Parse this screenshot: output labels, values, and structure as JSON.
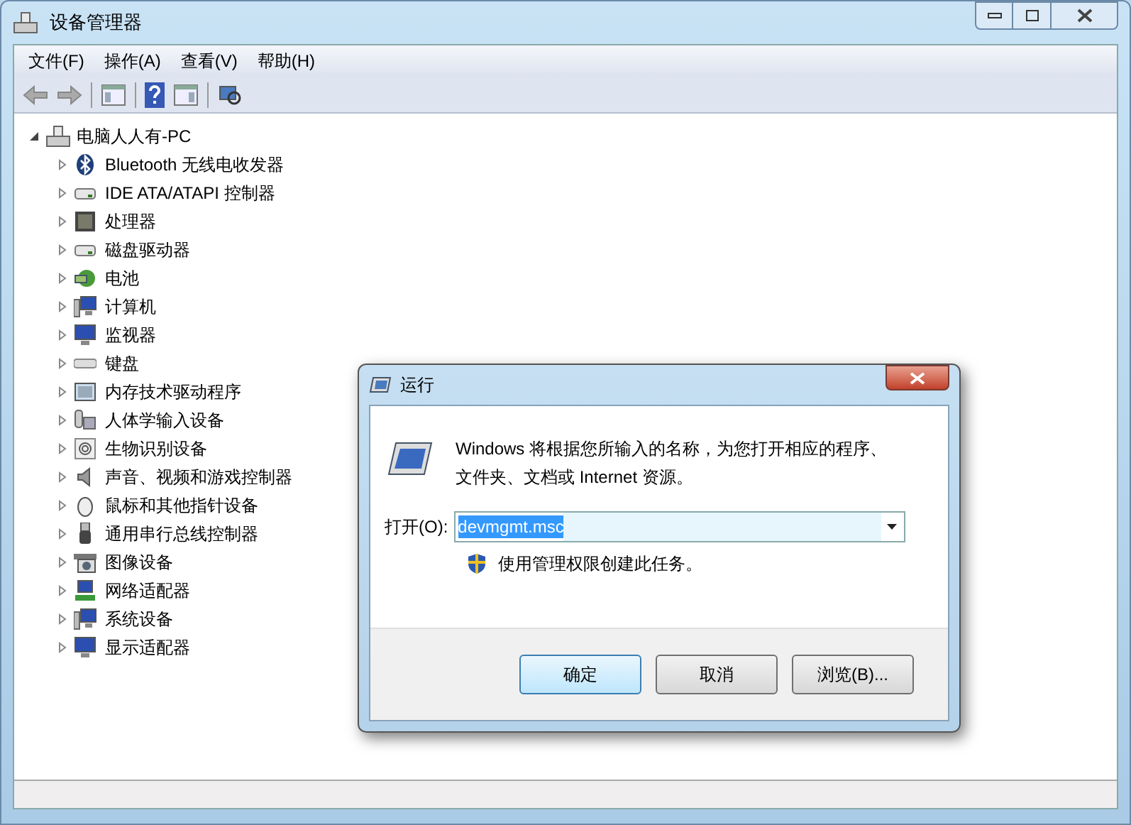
{
  "window": {
    "title": "设备管理器"
  },
  "menu": [
    "文件(F)",
    "操作(A)",
    "查看(V)",
    "帮助(H)"
  ],
  "tree": {
    "label": "电脑人人有-PC",
    "expanded": true,
    "children": [
      {
        "label": "Bluetooth 无线电收发器",
        "kind": "bluetooth",
        "expanded": false
      },
      {
        "label": "IDE ATA/ATAPI 控制器",
        "kind": "drive",
        "expanded": false
      },
      {
        "label": "处理器",
        "kind": "chip",
        "expanded": false
      },
      {
        "label": "磁盘驱动器",
        "kind": "drive",
        "expanded": false
      },
      {
        "label": "电池",
        "kind": "battery",
        "expanded": false
      },
      {
        "label": "计算机",
        "kind": "computer",
        "expanded": false
      },
      {
        "label": "监视器",
        "kind": "monitor",
        "expanded": false
      },
      {
        "label": "键盘",
        "kind": "keyboard",
        "expanded": false
      },
      {
        "label": "内存技术驱动程序",
        "kind": "memory",
        "expanded": false
      },
      {
        "label": "人体学输入设备",
        "kind": "hid",
        "expanded": false
      },
      {
        "label": "生物识别设备",
        "kind": "fingerprint",
        "expanded": false
      },
      {
        "label": "声音、视频和游戏控制器",
        "kind": "speaker",
        "expanded": false
      },
      {
        "label": "鼠标和其他指针设备",
        "kind": "mouse",
        "expanded": false
      },
      {
        "label": "通用串行总线控制器",
        "kind": "usb",
        "expanded": false
      },
      {
        "label": "图像设备",
        "kind": "camera",
        "expanded": false
      },
      {
        "label": "网络适配器",
        "kind": "network",
        "expanded": false
      },
      {
        "label": "系统设备",
        "kind": "computer",
        "expanded": false
      },
      {
        "label": "显示适配器",
        "kind": "monitor",
        "expanded": false
      }
    ]
  },
  "run_dialog": {
    "title": "运行",
    "description": "Windows 将根据您所输入的名称，为您打开相应的程序、文件夹、文档或 Internet 资源。",
    "open_label": "打开(O):",
    "value": "devmgmt.msc",
    "value_selected": true,
    "admin_note": "使用管理权限创建此任务。",
    "buttons": [
      {
        "label": "确定",
        "default": true
      },
      {
        "label": "取消",
        "default": false
      },
      {
        "label": "浏览(B)...",
        "default": false
      }
    ]
  }
}
